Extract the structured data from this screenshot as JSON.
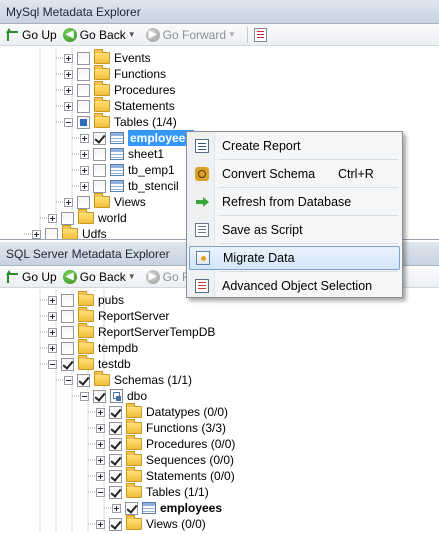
{
  "top_panel": {
    "title": "MySql Metadata Explorer",
    "toolbar": {
      "go_up": "Go Up",
      "go_back": "Go Back",
      "go_forward": "Go Forward"
    },
    "tree": [
      {
        "label": "Events",
        "expander": "plus",
        "check": "unchecked",
        "icon": "folder-icon"
      },
      {
        "label": "Functions",
        "expander": "plus",
        "check": "unchecked",
        "icon": "folder-icon"
      },
      {
        "label": "Procedures",
        "expander": "plus",
        "check": "unchecked",
        "icon": "folder-icon"
      },
      {
        "label": "Statements",
        "expander": "plus",
        "check": "unchecked",
        "icon": "folder-icon"
      },
      {
        "label": "Tables (1/4)",
        "expander": "minus",
        "check": "partial",
        "icon": "folder-icon"
      },
      {
        "label": "employees",
        "expander": "plus",
        "check": "checked",
        "icon": "table-icon",
        "selected": true
      },
      {
        "label": "sheet1",
        "expander": "plus",
        "check": "unchecked",
        "icon": "table-icon"
      },
      {
        "label": "tb_emp1",
        "expander": "plus",
        "check": "unchecked",
        "icon": "table-icon"
      },
      {
        "label": "tb_stencil",
        "expander": "plus",
        "check": "unchecked",
        "icon": "table-icon"
      },
      {
        "label": "Views",
        "expander": "plus",
        "check": "unchecked",
        "icon": "folder-icon"
      },
      {
        "label": "world",
        "expander": "plus",
        "check": "unchecked",
        "icon": "folder-icon"
      },
      {
        "label": "Udfs",
        "expander": "plus",
        "check": "unchecked",
        "icon": "folder-icon"
      }
    ]
  },
  "bottom_panel": {
    "title": "SQL Server Metadata Explorer",
    "toolbar": {
      "go_up": "Go Up",
      "go_back": "Go Back",
      "go_forward": "Go Forward"
    },
    "tree": [
      {
        "label": "pubs",
        "expander": "plus",
        "check": "unchecked",
        "icon": "folder-icon"
      },
      {
        "label": "ReportServer",
        "expander": "plus",
        "check": "unchecked",
        "icon": "folder-icon"
      },
      {
        "label": "ReportServerTempDB",
        "expander": "plus",
        "check": "unchecked",
        "icon": "folder-icon"
      },
      {
        "label": "tempdb",
        "expander": "plus",
        "check": "unchecked",
        "icon": "folder-icon"
      },
      {
        "label": "testdb",
        "expander": "minus",
        "check": "checked",
        "icon": "folder-icon"
      },
      {
        "label": "Schemas (1/1)",
        "expander": "minus",
        "check": "checked",
        "icon": "folder-icon"
      },
      {
        "label": "dbo",
        "expander": "minus",
        "check": "checked",
        "icon": "schema-icon"
      },
      {
        "label": "Datatypes (0/0)",
        "expander": "plus",
        "check": "checked",
        "icon": "folder-icon"
      },
      {
        "label": "Functions (3/3)",
        "expander": "plus",
        "check": "checked",
        "icon": "folder-icon"
      },
      {
        "label": "Procedures (0/0)",
        "expander": "plus",
        "check": "checked",
        "icon": "folder-icon"
      },
      {
        "label": "Sequences (0/0)",
        "expander": "plus",
        "check": "checked",
        "icon": "folder-icon"
      },
      {
        "label": "Statements (0/0)",
        "expander": "plus",
        "check": "checked",
        "icon": "folder-icon"
      },
      {
        "label": "Tables (1/1)",
        "expander": "minus",
        "check": "checked",
        "icon": "folder-icon"
      },
      {
        "label": "employees",
        "expander": "plus",
        "check": "checked",
        "icon": "table-icon",
        "bold": true
      },
      {
        "label": "Views (0/0)",
        "expander": "plus",
        "check": "checked",
        "icon": "folder-icon"
      }
    ]
  },
  "context_menu": {
    "items": [
      {
        "label": "Create Report",
        "shortcut": "",
        "icon": "report-icon"
      },
      {
        "label": "Convert Schema",
        "shortcut": "Ctrl+R",
        "icon": "convert-schema-icon"
      },
      {
        "label": "Refresh from Database",
        "shortcut": "",
        "icon": "refresh-arrow-icon"
      },
      {
        "label": "Save as Script",
        "shortcut": "",
        "icon": "script-icon"
      },
      {
        "label": "Migrate Data",
        "shortcut": "",
        "icon": "migrate-data-icon",
        "highlighted": true
      },
      {
        "label": "Advanced Object Selection",
        "shortcut": "",
        "icon": "object-selection-icon"
      }
    ]
  },
  "colors": {
    "selection": "#3399ff",
    "menu_highlight": "#d4e6f8",
    "title_bar": "#c8d3e1"
  }
}
